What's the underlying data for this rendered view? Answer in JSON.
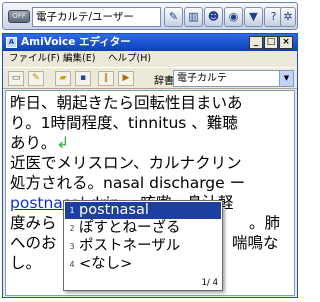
{
  "toolbar": {
    "onoff_label": "OFF",
    "dictionary_name": "電子カルテ/ユーザー",
    "buttons": [
      {
        "icon": "pencil-icon",
        "glyph": "✎"
      },
      {
        "icon": "book-icon",
        "glyph": "▥"
      },
      {
        "icon": "person-icon",
        "glyph": "☻"
      },
      {
        "icon": "microphone-icon",
        "glyph": "◉"
      },
      {
        "icon": "download-icon",
        "glyph": "▼"
      },
      {
        "icon": "help-icon",
        "glyph": "?"
      },
      {
        "icon": "settings-icon",
        "glyph": "✲"
      }
    ]
  },
  "window": {
    "title": "AmiVoice エディター",
    "minimize": "_",
    "maximize": "□",
    "close": "×"
  },
  "menu": [
    "ファイル(F)",
    "編集(E)",
    "ヘルプ(H)"
  ],
  "edit_toolbar": {
    "dict_label": "辞書",
    "dict_value": "電子カルテ"
  },
  "editor": {
    "lines": [
      "昨日、朝起きたら回転性目まいあ",
      "り。1時間程度、tinnitus 、難聴",
      "あり。",
      "近医でメリスロン、カルナクリン",
      "処方される。nasal discharge ー",
      "postnasal",
      " drip ー咳嗽、鼻汁軽",
      "度みら",
      "。肺",
      "へのお",
      "喘鳴な",
      "し。"
    ],
    "enter_mark": "↲"
  },
  "candidates": {
    "items": [
      "postnasal",
      "ぽすとねーざる",
      "ポストネーザル",
      "<なし>"
    ],
    "numbers": [
      "1",
      "2",
      "3",
      "4"
    ],
    "page": "1/ 4"
  }
}
